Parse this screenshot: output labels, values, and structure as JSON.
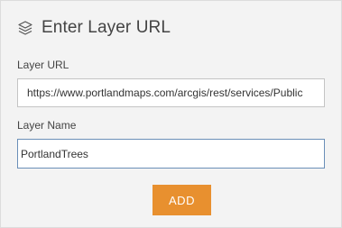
{
  "header": {
    "icon": "layers-icon",
    "title": "Enter Layer URL"
  },
  "form": {
    "url_label": "Layer URL",
    "url_value": "https://www.portlandmaps.com/arcgis/rest/services/Public",
    "name_label": "Layer Name",
    "name_value": "PortlandTrees"
  },
  "actions": {
    "add_label": "ADD"
  },
  "colors": {
    "accent": "#e8902f",
    "panel_bg": "#f3f3f3",
    "focus_border": "#6a8fb8"
  }
}
